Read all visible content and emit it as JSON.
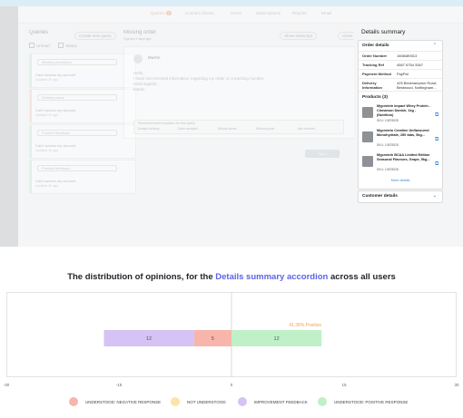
{
  "screenshot": {
    "tabs": [
      {
        "label": "Queries",
        "badge": "2",
        "active": true
      },
      {
        "label": "Connect Clients"
      },
      {
        "label": "Users"
      },
      {
        "label": "Subscriptions"
      },
      {
        "label": "Reports"
      },
      {
        "label": "Email"
      }
    ],
    "queries_panel": {
      "title": "Queries",
      "action_label": "Create new query",
      "filters": [
        "Unread",
        "Status"
      ],
      "cards": [
        {
          "pill": "Missing accessory",
          "line1": "Can't access my account",
          "line2": "Updated 2h ago",
          "accent": "#cfe8d5"
        },
        {
          "pill": "Delivery issue",
          "line1": "Can't access my account",
          "line2": "Updated 2h ago",
          "accent": "#f6d3c8"
        },
        {
          "pill": "Product feedback",
          "line1": "Can't access my account",
          "line2": "Updated 2h ago",
          "accent": "#cfe8d5"
        },
        {
          "pill": "Product feedback",
          "line1": "Can't access my account",
          "line2": "Updated 2h ago",
          "accent": "#cfe8d5"
        }
      ]
    },
    "middle": {
      "title": "Missing order",
      "subtitle": "Opened 2 days ago",
      "btn_view": "Show transcript",
      "btn_close": "Close",
      "sender": "Martin",
      "message": [
        "Hello,",
        "I have not received information regarding my order or a tracking number.",
        "Kind regards,",
        "Martin"
      ],
      "recommend_label": "Recommended templates for this query",
      "recommend_tags": [
        "Delayed delivery",
        "Order accepted",
        "Refund issued",
        "Delivery guide",
        "Item returned"
      ],
      "send_label": "Send"
    },
    "details": {
      "title": "Details summary",
      "order_header": "Order details",
      "order_rows": [
        {
          "k": "Order Number",
          "v": "1608489313"
        },
        {
          "k": "Tracking Ref",
          "v": "4567 6754 3367"
        },
        {
          "k": "Payment Method",
          "v": "PayPal"
        },
        {
          "k": "Delivery Information",
          "v": "425 Beckhampton Road, Bestwood, Nottingham..."
        }
      ],
      "products_header": "Products (3)",
      "products": [
        {
          "name": "Myprotein Impact Whey Protein - Cinnamon Danish, 1kg - (Nutrition)",
          "sku": "SKU: 10878528"
        },
        {
          "name": "Myprotein Creatine Unflavoured Monohydrate, 250 tabs, 5kg...",
          "sku": "SKU: 10878528"
        },
        {
          "name": "Myprotein BCAA Limited Edition Seasonal Flavours, Grape, 5kg...",
          "sku": "SKU: 10878528"
        }
      ],
      "more_label": "More details",
      "customer_header": "Customer details",
      "icons": {
        "chevron_up": "chevron-up-icon",
        "chevron_down": "chevron-down-icon",
        "external": "external-link-icon"
      }
    }
  },
  "title": {
    "prefix": "The distribution of opinions, for the ",
    "highlight": "Details summary accordion",
    "suffix": " across all users"
  },
  "chart_data": {
    "type": "bar",
    "orientation": "horizontal",
    "stacked": true,
    "xlim": [
      -30,
      30
    ],
    "xticks": [
      -30,
      -15,
      0,
      15,
      30
    ],
    "segments": [
      {
        "name": "UNDERSTOOD: NEGATIVE RESPONSE",
        "value": -5,
        "label": "5",
        "color": "#f7b5ab"
      },
      {
        "name": "IMPROVEMENT FEEDBACK",
        "value": -12,
        "label": "12",
        "color": "#d4c3f4"
      },
      {
        "name": "UNDERSTOOD: POSITIVE RESPONSE",
        "value": 12,
        "label": "12",
        "color": "#bff0c8"
      }
    ],
    "annotation": "41.38% Positive",
    "annotation_color": "#f1a64d",
    "legend": [
      {
        "label": "UNDERSTOOD: NEGATIVE RESPONSE",
        "color": "#f7b5ab"
      },
      {
        "label": "NOT UNDERSTOOD",
        "color": "#fde4a6"
      },
      {
        "label": "IMPROVEMENT FEEDBACK",
        "color": "#d4c3f4"
      },
      {
        "label": "UNDERSTOOD: POSITIVE RESPONSE",
        "color": "#bff0c8"
      }
    ],
    "legend_position": "bottom"
  }
}
